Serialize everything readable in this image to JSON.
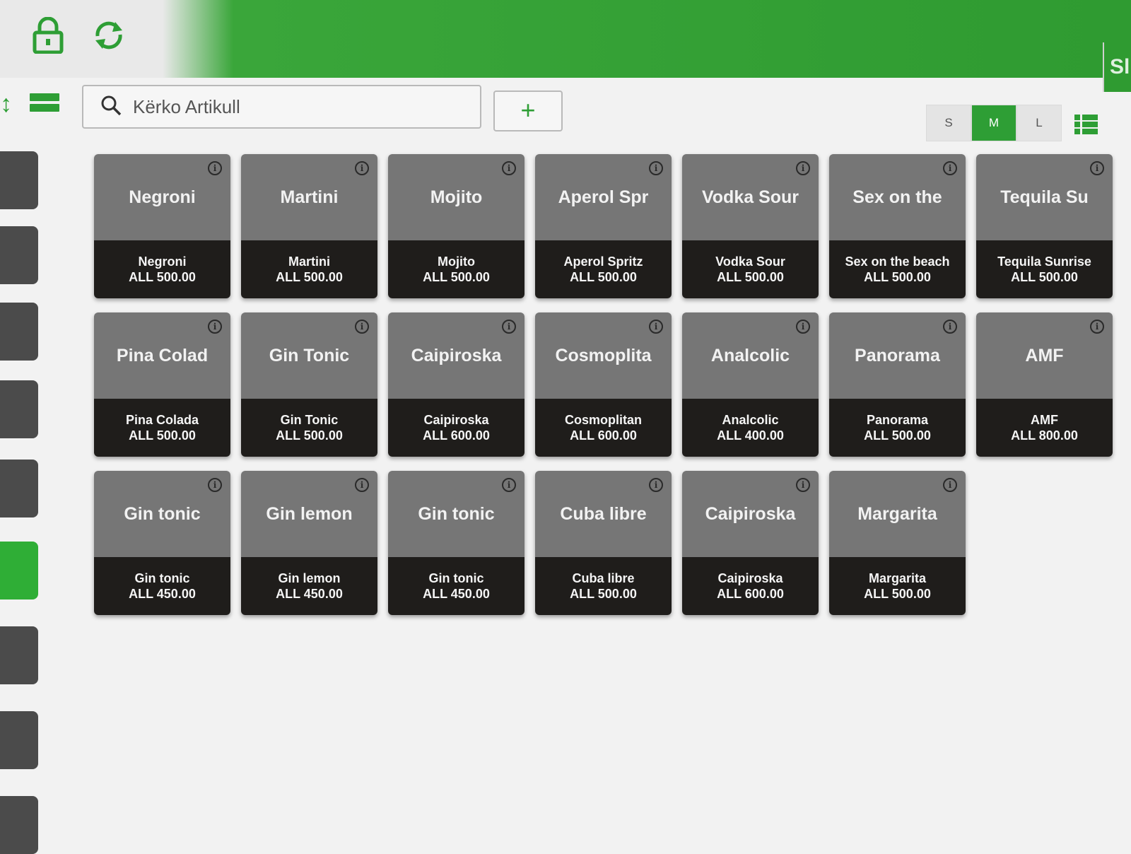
{
  "header": {
    "lock_icon": "lock-icon",
    "sync_icon": "sync-icon",
    "right_text": "Sl"
  },
  "toolbar": {
    "search_placeholder": "Kërko Artikull",
    "add_label": "+",
    "sizes": [
      "S",
      "M",
      "L"
    ],
    "active_size": "M"
  },
  "colors": {
    "accent": "#2e9e35",
    "tile_top": "#767676",
    "tile_bottom": "#1f1d1b"
  },
  "tiles": [
    {
      "title": "Negroni",
      "name": "Negroni",
      "price": "ALL 500.00"
    },
    {
      "title": "Martini",
      "name": "Martini",
      "price": "ALL 500.00"
    },
    {
      "title": "Mojito",
      "name": "Mojito",
      "price": "ALL 500.00"
    },
    {
      "title": "Aperol Spr",
      "name": "Aperol Spritz",
      "price": "ALL 500.00"
    },
    {
      "title": "Vodka Sour",
      "name": "Vodka Sour",
      "price": "ALL 500.00"
    },
    {
      "title": "Sex on the",
      "name": "Sex on the beach",
      "price": "ALL 500.00"
    },
    {
      "title": "Tequila Su",
      "name": "Tequila Sunrise",
      "price": "ALL 500.00"
    },
    {
      "title": "Pina Colad",
      "name": "Pina Colada",
      "price": "ALL 500.00"
    },
    {
      "title": "Gin Tonic",
      "name": "Gin Tonic",
      "price": "ALL 500.00"
    },
    {
      "title": "Caipiroska",
      "name": "Caipiroska",
      "price": "ALL 600.00"
    },
    {
      "title": "Cosmoplita",
      "name": "Cosmoplitan",
      "price": "ALL 600.00"
    },
    {
      "title": "Analcolic",
      "name": "Analcolic",
      "price": "ALL 400.00"
    },
    {
      "title": "Panorama",
      "name": "Panorama",
      "price": "ALL 500.00"
    },
    {
      "title": "AMF",
      "name": "AMF",
      "price": "ALL 800.00"
    },
    {
      "title": "Gin tonic",
      "name": "Gin tonic",
      "price": "ALL 450.00"
    },
    {
      "title": "Gin lemon",
      "name": "Gin lemon",
      "price": "ALL 450.00"
    },
    {
      "title": "Gin tonic",
      "name": "Gin tonic",
      "price": "ALL 450.00"
    },
    {
      "title": "Cuba libre",
      "name": "Cuba libre",
      "price": "ALL 500.00"
    },
    {
      "title": "Caipiroska",
      "name": "Caipiroska",
      "price": "ALL 600.00"
    },
    {
      "title": "Margarita",
      "name": "Margarita",
      "price": "ALL 500.00"
    }
  ]
}
